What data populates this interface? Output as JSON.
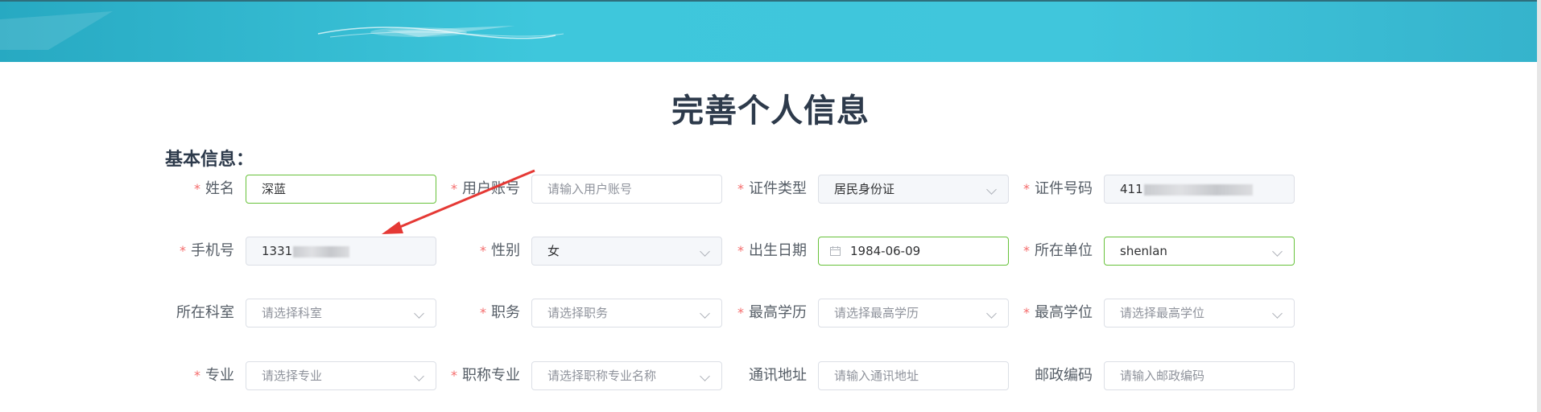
{
  "page": {
    "title": "完善个人信息",
    "section_title": "基本信息："
  },
  "fields": {
    "name": {
      "label": "姓名",
      "required": true,
      "value": "深蓝"
    },
    "username": {
      "label": "用户账号",
      "required": true,
      "placeholder": "请输入用户账号"
    },
    "id_type": {
      "label": "证件类型",
      "required": true,
      "value": "居民身份证"
    },
    "id_number": {
      "label": "证件号码",
      "required": true,
      "value_visible_prefix": "411"
    },
    "phone": {
      "label": "手机号",
      "required": true,
      "value_visible_prefix": "1331"
    },
    "gender": {
      "label": "性别",
      "required": true,
      "value": "女"
    },
    "birth_date": {
      "label": "出生日期",
      "required": true,
      "value": "1984-06-09"
    },
    "organization": {
      "label": "所在单位",
      "required": true,
      "value": "shenlan"
    },
    "department": {
      "label": "所在科室",
      "required": false,
      "placeholder": "请选择科室"
    },
    "position": {
      "label": "职务",
      "required": true,
      "placeholder": "请选择职务"
    },
    "education": {
      "label": "最高学历",
      "required": true,
      "placeholder": "请选择最高学历"
    },
    "degree": {
      "label": "最高学位",
      "required": true,
      "placeholder": "请选择最高学位"
    },
    "major": {
      "label": "专业",
      "required": true,
      "placeholder": "请选择专业"
    },
    "title_major": {
      "label": "职称专业",
      "required": true,
      "placeholder": "请选择职称专业名称"
    },
    "address": {
      "label": "通讯地址",
      "required": false,
      "placeholder": "请输入通讯地址"
    },
    "postcode": {
      "label": "邮政编码",
      "required": false,
      "placeholder": "请输入邮政编码"
    }
  },
  "required_mark": "*",
  "colors": {
    "banner": "#3ec7dc",
    "required": "#f56c6c",
    "valid_border": "#67c23a",
    "annotation_arrow": "#e53935"
  }
}
